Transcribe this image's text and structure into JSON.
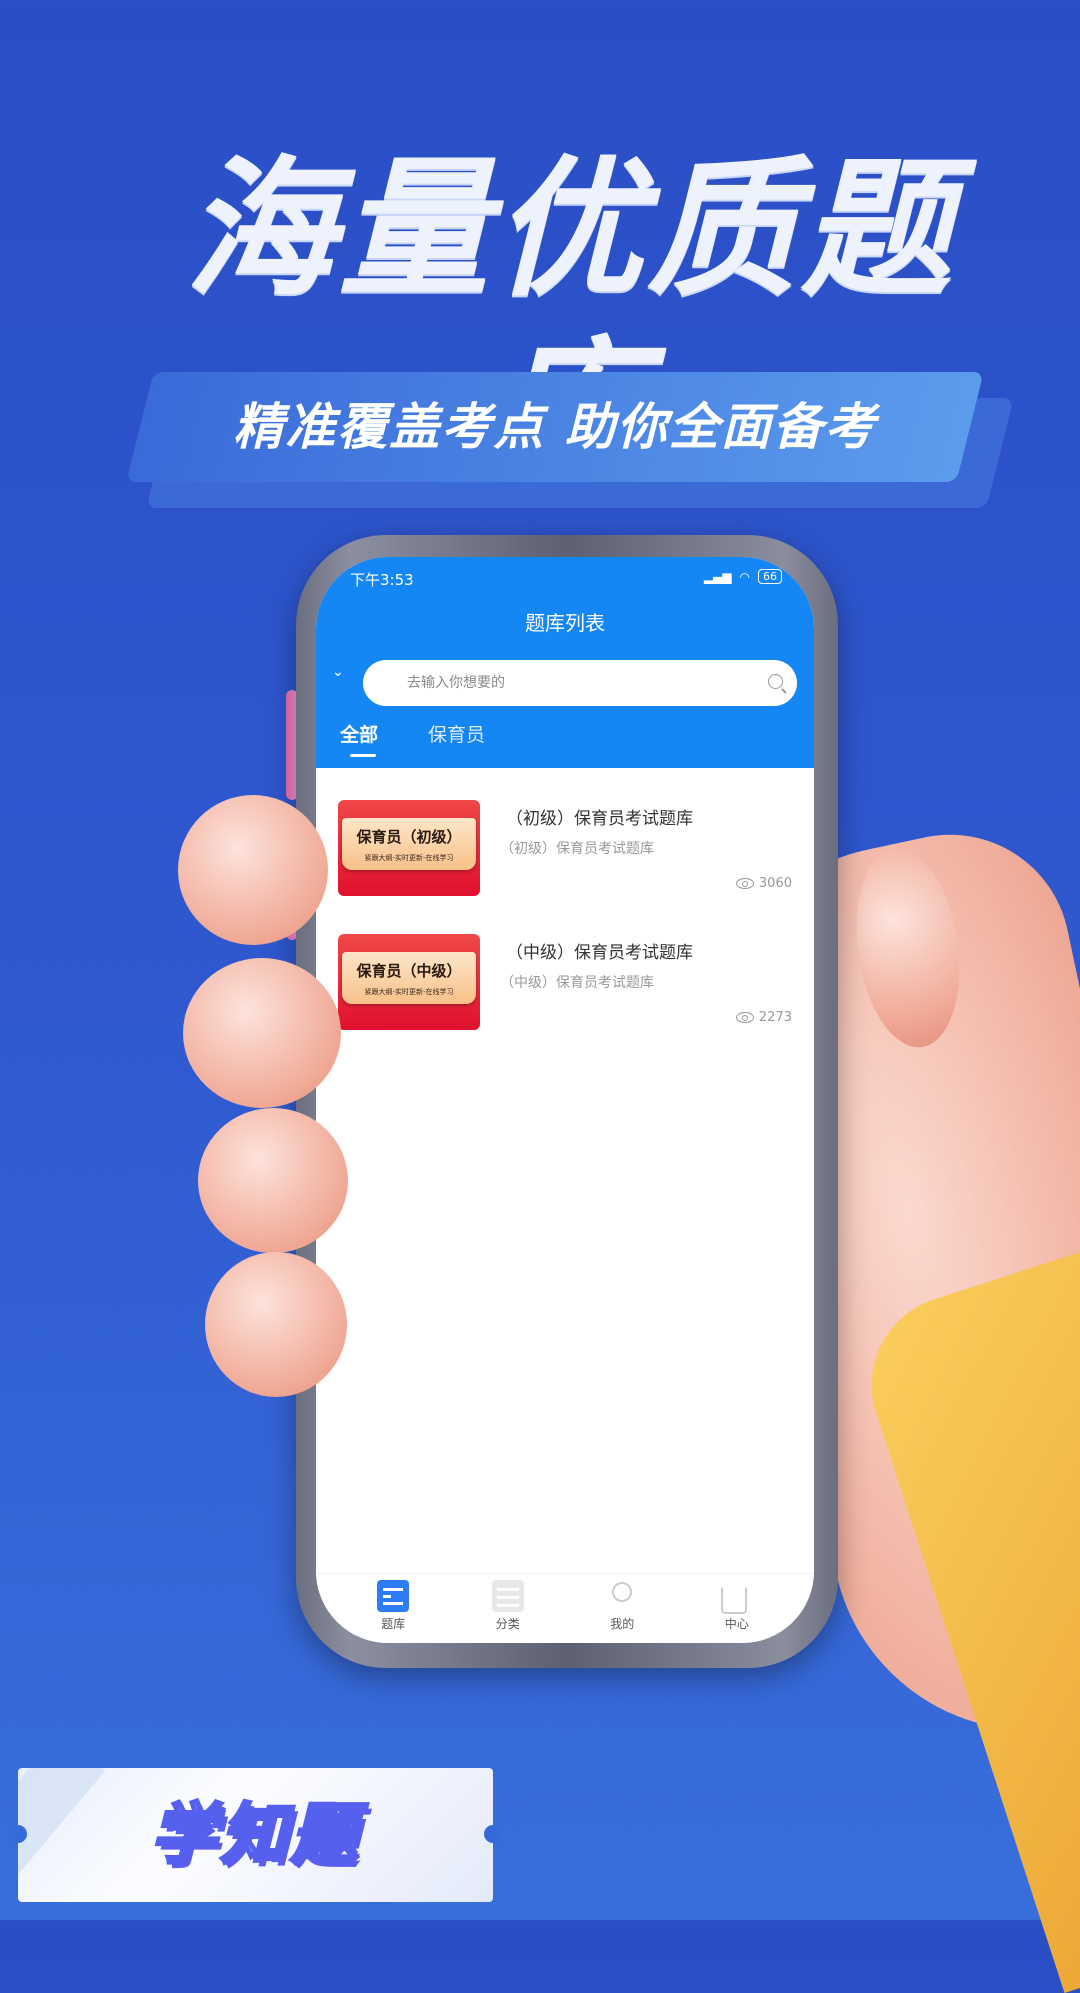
{
  "promo": {
    "headline": "海量优质题库",
    "slogan": "精准覆盖考点  助你全面备考",
    "brand": "学知题"
  },
  "colors": {
    "background": "#2f58cf",
    "app_primary": "#1587f4",
    "thumb_red": "#e0102e"
  },
  "status_bar": {
    "time": "下午3:53",
    "signal": "HD",
    "battery": "66"
  },
  "app": {
    "title": "题库列表",
    "search": {
      "placeholder": "去输入你想要的",
      "value": ""
    },
    "tabs": [
      {
        "label": "全部",
        "active": true
      },
      {
        "label": "保育员",
        "active": false
      }
    ],
    "items": [
      {
        "thumb_title": "保育员（初级）",
        "thumb_sub": "紧跟大纲-实时更新-在线学习",
        "title": "（初级）保育员考试题库",
        "subtitle": "（初级）保育员考试题库",
        "views": "3060"
      },
      {
        "thumb_title": "保育员（中级）",
        "thumb_sub": "紧跟大纲-实时更新-在线学习",
        "title": "（中级）保育员考试题库",
        "subtitle": "（中级）保育员考试题库",
        "views": "2273"
      }
    ],
    "nav": [
      {
        "label": "题库",
        "icon": "question-bank-icon",
        "active": true
      },
      {
        "label": "分类",
        "icon": "category-icon",
        "active": false
      },
      {
        "label": "我的",
        "icon": "profile-icon",
        "active": false
      },
      {
        "label": "中心",
        "icon": "home-icon",
        "active": false
      }
    ]
  }
}
